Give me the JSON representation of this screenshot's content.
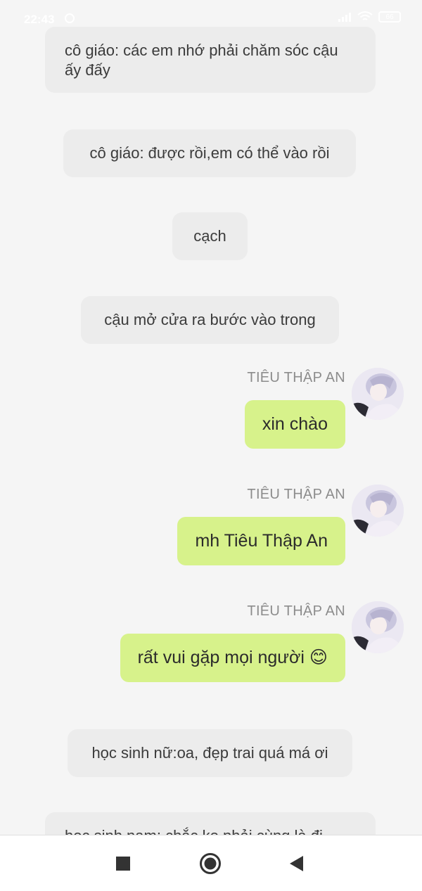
{
  "status_bar": {
    "time": "22:43",
    "battery": "66"
  },
  "messages": [
    {
      "type": "narration",
      "text": "cô giáo: các em nhớ phải chăm sóc cậu ấy đấy"
    },
    {
      "type": "narration",
      "text": "cô giáo: được rồi,em có thể vào rồi"
    },
    {
      "type": "narration",
      "text": "cạch"
    },
    {
      "type": "narration",
      "text": "cậu mở cửa ra bước vào trong"
    },
    {
      "type": "chat",
      "sender": "TIÊU THẬP AN",
      "text": "xin chào"
    },
    {
      "type": "chat",
      "sender": "TIÊU THẬP AN",
      "text": "mh Tiêu Thập An"
    },
    {
      "type": "chat",
      "sender": "TIÊU THẬP AN",
      "text": "rất vui gặp mọi người 😊"
    },
    {
      "type": "narration",
      "text": "học sinh nữ:oa, đẹp trai quá má ơi"
    },
    {
      "type": "narration",
      "text": "học sinh nam: chắc ko phải cùng là đi"
    }
  ],
  "nav_bar": {
    "icons": [
      "square-recents-icon",
      "circle-home-icon",
      "triangle-back-icon"
    ]
  },
  "colors": {
    "background": "#f5f5f5",
    "narration_bubble": "#ececec",
    "chat_bubble": "#d7f28b",
    "sender_name": "#8c8c8c"
  }
}
